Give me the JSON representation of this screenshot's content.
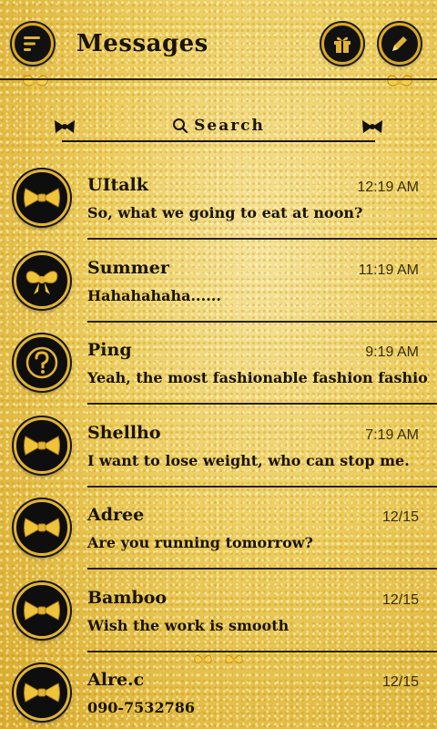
{
  "header": {
    "title": "Messages",
    "menu_icon": "menu-icon",
    "gift_icon": "gift-icon",
    "edit_icon": "pencil-icon"
  },
  "search": {
    "label": "Search",
    "icon": "search-icon"
  },
  "colors": {
    "gold": "#e2b436",
    "ink": "#1a1407",
    "black": "#0e0e0e"
  },
  "conversations": [
    {
      "name": "UItalk",
      "time": "12:19 AM",
      "preview": "So, what we going to eat at noon?",
      "avatar": "bow-tie-icon"
    },
    {
      "name": "Summer",
      "time": "11:19 AM",
      "preview": "Hahahahaha......",
      "avatar": "bow-icon"
    },
    {
      "name": "Ping",
      "time": "9:19 AM",
      "preview": "Yeah, the most fashionable fashion fashion..",
      "avatar": "question-icon"
    },
    {
      "name": "Shellho",
      "time": "7:19 AM",
      "preview": "I want to lose weight, who can stop me.",
      "avatar": "bow-tie-icon"
    },
    {
      "name": "Adree",
      "time": "12/15",
      "preview": "Are you running tomorrow?",
      "avatar": "bow-tie-icon"
    },
    {
      "name": "Bamboo",
      "time": "12/15",
      "preview": "Wish the work is smooth",
      "avatar": "bow-tie-icon"
    },
    {
      "name": "Alre.c",
      "time": "12/15",
      "preview": "090-7532786",
      "avatar": "bow-tie-icon"
    }
  ]
}
